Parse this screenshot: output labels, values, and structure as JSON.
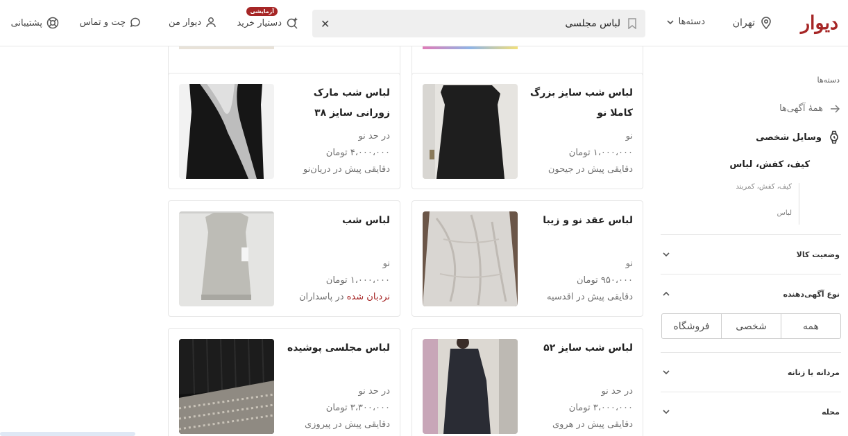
{
  "header": {
    "logo": "دیوار",
    "city": "تهران",
    "categories": "دسته‌ها",
    "search_value": "لباس مجلسی",
    "shopping_assistant": "دستیار خرید",
    "assistant_badge": "آزمایشی",
    "my_divar": "دیوار من",
    "chat": "چت و تماس",
    "support": "پشتیبانی"
  },
  "sidebar": {
    "title": "دسته‌ها",
    "all_ads": "همهٔ آگهی‌ها",
    "category": "وسایل شخصی",
    "subcategory": "کیف، کفش، لباس",
    "tree": [
      "کیف، کفش، کمربند",
      "لباس"
    ],
    "filters": [
      "وضعیت کالا",
      "نوع آگهی‌دهنده",
      "مردانه یا زنانه",
      "محله"
    ],
    "advertiser_options": [
      "همه",
      "شخصی",
      "فروشگاه"
    ]
  },
  "listings": [
    {
      "title": "لباس شب سایز بزرگ کاملا نو",
      "condition": "نو",
      "price": "۱،۰۰۰،۰۰۰ تومان",
      "meta": "دقایقی پیش در جیحون"
    },
    {
      "title": "لباس شب مارک زورانی سایز ۳۸",
      "condition": "در حد نو",
      "price": "۴،۰۰۰،۰۰۰ تومان",
      "meta": "دقایقی پیش در دریان‌نو"
    },
    {
      "title": "لباس عقد نو و زیبا",
      "condition": "نو",
      "price": "۹۵۰،۰۰۰ تومان",
      "meta": "دقایقی پیش در اقدسیه"
    },
    {
      "title": "لباس شب",
      "condition": "نو",
      "price": "۱،۰۰۰،۰۰۰ تومان",
      "meta_ladder": "نردبان شده",
      "meta_location": "در پاسداران"
    },
    {
      "title": "لباس شب سایز ۵۲",
      "condition": "در حد نو",
      "price": "۳،۰۰۰،۰۰۰ تومان",
      "meta": "دقایقی پیش در هروی"
    },
    {
      "title": "لباس مجلسی پوشیده",
      "condition": "در حد نو",
      "price": "۳،۳۰۰،۰۰۰ تومان",
      "meta": "دقایقی پیش در پیروزی"
    }
  ],
  "colors": {
    "brand": "#a62626"
  }
}
